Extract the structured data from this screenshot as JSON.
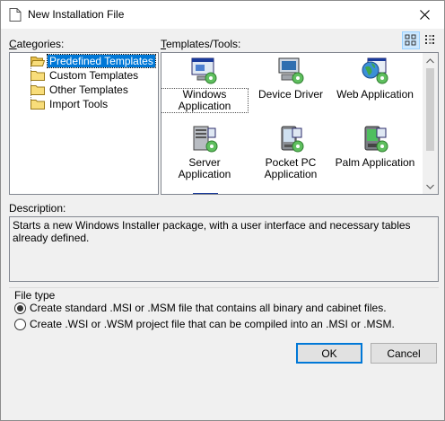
{
  "window": {
    "title": "New Installation File"
  },
  "categories": {
    "label": "Categories:",
    "items": [
      {
        "label": "Predefined Templates",
        "selected": true
      },
      {
        "label": "Custom Templates",
        "selected": false
      },
      {
        "label": "Other Templates",
        "selected": false
      },
      {
        "label": "Import Tools",
        "selected": false
      }
    ]
  },
  "templates": {
    "label": "Templates/Tools:",
    "items": [
      {
        "label": "Windows Application",
        "icon": "windows-app-icon",
        "selected": true
      },
      {
        "label": "Device Driver",
        "icon": "device-driver-icon"
      },
      {
        "label": "Web Application",
        "icon": "web-app-icon"
      },
      {
        "label": "Server Application",
        "icon": "server-app-icon"
      },
      {
        "label": "Pocket PC Application",
        "icon": "pocket-pc-icon"
      },
      {
        "label": "Palm Application",
        "icon": "palm-app-icon"
      }
    ]
  },
  "description": {
    "label": "Description:",
    "text": "Starts a new Windows Installer package, with a user interface and necessary tables already defined."
  },
  "file_type": {
    "label": "File type",
    "options": [
      {
        "label": "Create standard .MSI or .MSM file that contains all binary and cabinet files.",
        "checked": true
      },
      {
        "label": "Create .WSI or .WSM project file that can be compiled into an .MSI or .MSM.",
        "checked": false
      }
    ]
  },
  "buttons": {
    "ok": "OK",
    "cancel": "Cancel"
  },
  "colors": {
    "selection": "#0078d7",
    "folder": "#f5d76e",
    "accent_border": "#0078d7"
  }
}
